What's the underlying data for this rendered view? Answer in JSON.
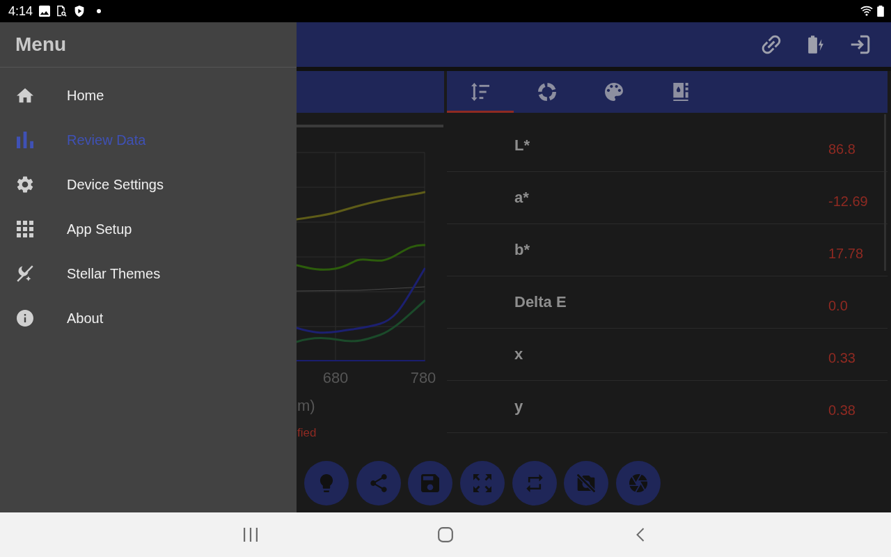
{
  "status_bar": {
    "time": "4:14"
  },
  "drawer": {
    "title": "Menu",
    "items": [
      {
        "label": "Home",
        "selected": false
      },
      {
        "label": "Review Data",
        "selected": true
      },
      {
        "label": "Device Settings",
        "selected": false
      },
      {
        "label": "App Setup",
        "selected": false
      },
      {
        "label": "Stellar Themes",
        "selected": false
      },
      {
        "label": "About",
        "selected": false
      }
    ]
  },
  "spectrum_panel": {
    "x_tick_labels": [
      "680",
      "780"
    ],
    "x_axis_title": "m)",
    "note": "fied"
  },
  "measurement_panel": {
    "tabs": [
      {
        "selected": true
      },
      {
        "selected": false
      },
      {
        "selected": false
      },
      {
        "selected": false
      }
    ],
    "rows": [
      {
        "label": "L*",
        "value": "86.8"
      },
      {
        "label": "a*",
        "value": "-12.69"
      },
      {
        "label": "b*",
        "value": "17.78"
      },
      {
        "label": "Delta E",
        "value": "0.0"
      },
      {
        "label": "x",
        "value": "0.33"
      },
      {
        "label": "y",
        "value": "0.38"
      }
    ]
  }
}
